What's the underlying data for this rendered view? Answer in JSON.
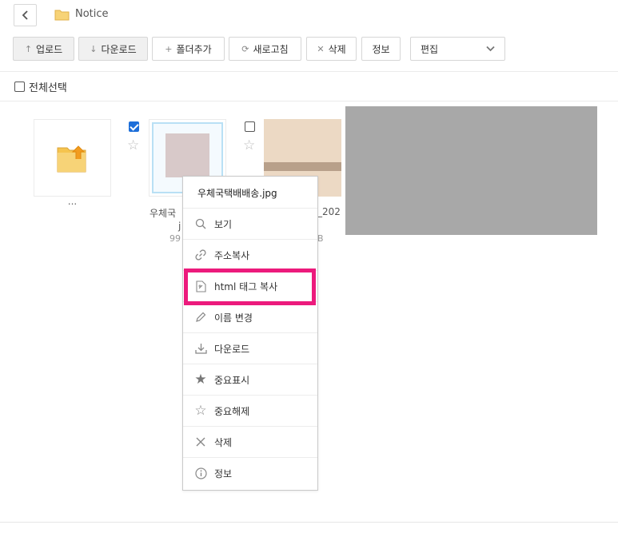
{
  "breadcrumb": {
    "folder_name": "Notice"
  },
  "toolbar": {
    "upload": "업로드",
    "download": "다운로드",
    "add_folder": "폴더추가",
    "refresh": "새로고침",
    "delete": "삭제",
    "info": "정보",
    "edit_select": "편집"
  },
  "select_all_label": "전체선택",
  "files": {
    "parent_label": "...",
    "file1": {
      "name_line1": "우체국",
      "name_line2": "j",
      "size": "99",
      "checked": true
    },
    "file2": {
      "name_fragment": "_202",
      "size_fragment": "B",
      "checked": false
    }
  },
  "context_menu": {
    "title": "우체국택배배송.jpg",
    "items": [
      {
        "label": "보기",
        "icon": "search-icon"
      },
      {
        "label": "주소복사",
        "icon": "link-icon"
      },
      {
        "label": "html 태그 복사",
        "icon": "html-file-icon",
        "highlighted": true
      },
      {
        "label": "이름 변경",
        "icon": "pencil-icon"
      },
      {
        "label": "다운로드",
        "icon": "download-icon"
      },
      {
        "label": "중요표시",
        "icon": "star-filled-icon"
      },
      {
        "label": "중요해제",
        "icon": "star-outline-icon"
      },
      {
        "label": "삭제",
        "icon": "close-icon"
      },
      {
        "label": "정보",
        "icon": "info-icon"
      }
    ]
  },
  "colors": {
    "highlight_border": "#ec1a7c",
    "checkbox_checked": "#1e6fd9",
    "folder_yellow": "#f5c44e",
    "redacted_block": "#a8a8a8"
  }
}
